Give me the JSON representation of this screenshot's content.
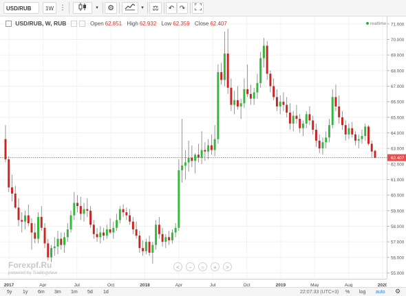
{
  "toolbar": {
    "symbol": "USD/RUB",
    "interval": "1W",
    "icons": [
      "more-vertical-icon",
      "candlestick-icon",
      "chevron-down-icon",
      "gear-icon",
      "indicators-icon",
      "chevron-down-icon",
      "scales-icon",
      "undo-icon",
      "redo-icon",
      "fullscreen-icon"
    ]
  },
  "legend": {
    "title": "USD/RUB, W, RUB",
    "open_label": "Open",
    "open": "62.851",
    "high_label": "High",
    "high": "62.932",
    "low_label": "Low",
    "low": "62.359",
    "close_label": "Close",
    "close": "62.407"
  },
  "realtime_label": "realtime",
  "watermark": {
    "brand": "Forexpf.Ru",
    "powered": "powered by TradingView"
  },
  "colors": {
    "up": "#32b83a",
    "down": "#cc2323",
    "price_line": "#e25050",
    "axis_text": "#555555",
    "current_bg": "#e84c4c"
  },
  "price_axis": {
    "ticks": [
      "71.000",
      "70.000",
      "69.000",
      "68.000",
      "67.000",
      "66.000",
      "65.000",
      "64.000",
      "63.000",
      "62.000",
      "61.000",
      "60.000",
      "59.000",
      "58.000",
      "57.000",
      "56.000",
      "55.000"
    ],
    "current": "62.407"
  },
  "time_axis": {
    "labels": [
      "2017",
      "Apr",
      "Jul",
      "Oct",
      "2018",
      "Apr",
      "Jul",
      "Oct",
      "2019",
      "May",
      "Aug",
      "2020"
    ],
    "bold": [
      "2017",
      "2018",
      "2019",
      "2020"
    ]
  },
  "bottom_bar": {
    "ranges": [
      "5y",
      "1y",
      "6m",
      "3m",
      "1m",
      "5d",
      "1d"
    ],
    "clock": "22:07:33 (UTC+3)",
    "pct": "%",
    "log": "log",
    "auto": "auto"
  },
  "nav_buttons": [
    "<",
    "−",
    "○",
    "+",
    ">"
  ],
  "chart_data": {
    "type": "candlestick",
    "title": "USD/RUB, W, RUB",
    "interval": "weekly",
    "x_range": [
      "2017-01",
      "2019-12"
    ],
    "ylim": [
      54.8,
      71.3
    ],
    "y_scale": "linear",
    "candles": [
      [
        63.6,
        64.5,
        62.1,
        62.3
      ],
      [
        62.3,
        62.5,
        60.2,
        60.5
      ],
      [
        60.5,
        61.3,
        59.6,
        60.1
      ],
      [
        60.1,
        60.6,
        59.1,
        59.2
      ],
      [
        59.2,
        59.8,
        58.0,
        58.4
      ],
      [
        58.4,
        58.9,
        57.6,
        58.3
      ],
      [
        58.3,
        59.0,
        57.8,
        58.7
      ],
      [
        58.7,
        59.4,
        58.0,
        58.2
      ],
      [
        58.2,
        58.5,
        56.5,
        57.6
      ],
      [
        57.6,
        58.2,
        56.9,
        57.2
      ],
      [
        57.2,
        58.9,
        56.9,
        58.6
      ],
      [
        58.6,
        59.3,
        57.7,
        57.9
      ],
      [
        57.9,
        58.2,
        56.6,
        56.9
      ],
      [
        56.9,
        57.2,
        55.8,
        56.0
      ],
      [
        56.0,
        56.8,
        55.7,
        56.6
      ],
      [
        56.6,
        57.3,
        56.1,
        56.7
      ],
      [
        56.7,
        57.7,
        56.2,
        57.2
      ],
      [
        57.2,
        57.6,
        56.5,
        56.8
      ],
      [
        56.8,
        57.6,
        56.3,
        57.3
      ],
      [
        57.3,
        58.2,
        57.0,
        57.8
      ],
      [
        57.8,
        59.0,
        57.6,
        58.7
      ],
      [
        58.7,
        60.2,
        58.4,
        59.5
      ],
      [
        59.5,
        60.0,
        58.9,
        59.3
      ],
      [
        59.3,
        59.9,
        58.4,
        58.8
      ],
      [
        58.8,
        59.5,
        58.3,
        59.1
      ],
      [
        59.1,
        59.8,
        58.6,
        59.0
      ],
      [
        59.0,
        59.3,
        57.9,
        58.1
      ],
      [
        58.1,
        58.4,
        57.2,
        57.5
      ],
      [
        57.5,
        57.9,
        57.0,
        57.3
      ],
      [
        57.3,
        58.0,
        56.9,
        57.6
      ],
      [
        57.6,
        57.9,
        57.1,
        57.4
      ],
      [
        57.4,
        58.1,
        57.2,
        57.8
      ],
      [
        57.8,
        58.5,
        57.5,
        57.6
      ],
      [
        57.6,
        58.3,
        57.2,
        57.9
      ],
      [
        57.9,
        58.8,
        57.7,
        58.4
      ],
      [
        58.4,
        59.3,
        58.2,
        59.1
      ],
      [
        59.1,
        59.4,
        58.6,
        58.9
      ],
      [
        58.9,
        59.2,
        58.4,
        58.7
      ],
      [
        58.7,
        59.1,
        58.1,
        58.3
      ],
      [
        58.3,
        58.6,
        57.5,
        57.8
      ],
      [
        57.8,
        58.3,
        57.2,
        57.4
      ],
      [
        57.4,
        57.7,
        56.3,
        56.6
      ],
      [
        56.6,
        57.1,
        56.1,
        56.4
      ],
      [
        56.4,
        57.2,
        56.2,
        57.0
      ],
      [
        57.0,
        57.4,
        56.1,
        56.3
      ],
      [
        56.3,
        57.0,
        55.6,
        56.8
      ],
      [
        56.8,
        58.4,
        56.5,
        58.1
      ],
      [
        58.1,
        58.6,
        57.2,
        57.5
      ],
      [
        57.5,
        57.9,
        56.7,
        57.0
      ],
      [
        57.0,
        57.5,
        56.6,
        57.3
      ],
      [
        57.3,
        57.7,
        56.8,
        57.1
      ],
      [
        57.1,
        57.8,
        56.9,
        57.6
      ],
      [
        57.6,
        58.2,
        57.3,
        57.9
      ],
      [
        57.9,
        62.3,
        57.7,
        61.6
      ],
      [
        61.6,
        64.9,
        60.8,
        61.9
      ],
      [
        61.9,
        62.9,
        61.0,
        62.1
      ],
      [
        62.1,
        63.5,
        61.5,
        62.4
      ],
      [
        62.4,
        63.2,
        61.8,
        62.2
      ],
      [
        62.2,
        62.7,
        61.4,
        62.6
      ],
      [
        62.6,
        63.3,
        62.1,
        62.4
      ],
      [
        62.4,
        64.1,
        62.0,
        62.9
      ],
      [
        62.9,
        63.4,
        62.2,
        62.8
      ],
      [
        62.8,
        63.6,
        62.3,
        63.2
      ],
      [
        63.2,
        63.9,
        62.6,
        62.9
      ],
      [
        62.9,
        64.5,
        62.5,
        63.6
      ],
      [
        63.6,
        68.4,
        63.3,
        67.9
      ],
      [
        67.9,
        68.5,
        67.1,
        67.4
      ],
      [
        67.4,
        70.5,
        67.0,
        69.1
      ],
      [
        69.1,
        70.7,
        66.5,
        66.9
      ],
      [
        66.9,
        67.5,
        65.4,
        65.8
      ],
      [
        65.8,
        66.7,
        65.2,
        66.1
      ],
      [
        66.1,
        67.0,
        65.5,
        65.7
      ],
      [
        65.7,
        66.2,
        64.9,
        65.9
      ],
      [
        65.9,
        67.5,
        65.6,
        66.8
      ],
      [
        66.8,
        68.4,
        66.3,
        66.5
      ],
      [
        66.5,
        67.1,
        65.8,
        66.2
      ],
      [
        66.2,
        66.9,
        65.8,
        66.6
      ],
      [
        66.6,
        67.8,
        66.2,
        67.2
      ],
      [
        67.2,
        69.2,
        66.9,
        68.8
      ],
      [
        68.8,
        70.1,
        68.2,
        69.6
      ],
      [
        69.6,
        69.9,
        67.4,
        67.8
      ],
      [
        67.8,
        68.0,
        66.6,
        67.0
      ],
      [
        67.0,
        67.5,
        66.1,
        66.3
      ],
      [
        66.3,
        66.8,
        65.4,
        65.7
      ],
      [
        65.7,
        66.4,
        65.2,
        66.0
      ],
      [
        66.0,
        66.6,
        65.4,
        65.8
      ],
      [
        65.8,
        66.3,
        65.0,
        65.3
      ],
      [
        65.3,
        65.9,
        64.2,
        64.6
      ],
      [
        64.6,
        65.4,
        64.1,
        65.1
      ],
      [
        65.1,
        65.8,
        64.6,
        64.9
      ],
      [
        64.9,
        65.2,
        64.0,
        64.3
      ],
      [
        64.3,
        64.8,
        63.8,
        64.6
      ],
      [
        64.6,
        65.4,
        64.3,
        65.2
      ],
      [
        65.2,
        65.7,
        64.5,
        64.8
      ],
      [
        64.8,
        65.1,
        63.9,
        64.2
      ],
      [
        64.2,
        64.6,
        63.1,
        63.5
      ],
      [
        63.5,
        63.9,
        62.7,
        63.0
      ],
      [
        63.0,
        63.7,
        62.6,
        63.4
      ],
      [
        63.4,
        64.1,
        63.0,
        63.7
      ],
      [
        63.7,
        64.9,
        63.4,
        64.5
      ],
      [
        64.5,
        66.8,
        64.3,
        66.3
      ],
      [
        66.3,
        67.1,
        65.4,
        65.7
      ],
      [
        65.7,
        66.4,
        64.6,
        65.0
      ],
      [
        65.0,
        65.4,
        64.2,
        64.5
      ],
      [
        64.5,
        64.8,
        63.5,
        63.9
      ],
      [
        63.9,
        64.6,
        63.6,
        64.3
      ],
      [
        64.3,
        64.7,
        63.7,
        63.9
      ],
      [
        63.9,
        64.1,
        63.2,
        63.5
      ],
      [
        63.5,
        63.9,
        63.0,
        63.6
      ],
      [
        63.6,
        64.2,
        63.3,
        63.8
      ],
      [
        63.8,
        64.6,
        63.5,
        64.4
      ],
      [
        64.4,
        64.5,
        63.2,
        63.3
      ],
      [
        63.3,
        63.5,
        62.4,
        62.8
      ],
      [
        62.85,
        62.93,
        62.36,
        62.41
      ]
    ]
  }
}
